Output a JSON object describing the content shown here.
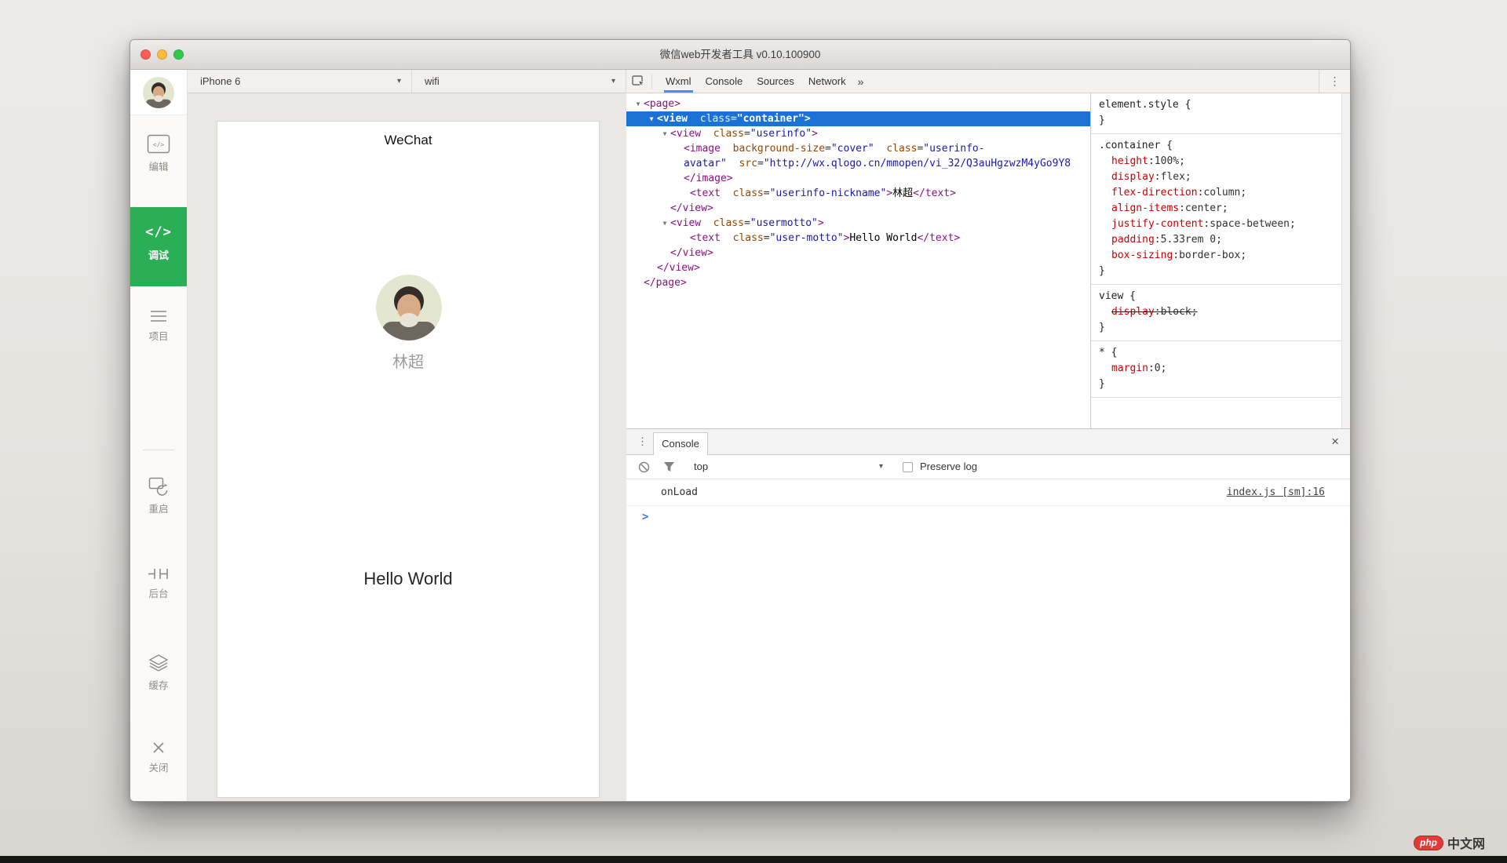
{
  "window": {
    "title": "微信web开发者工具 v0.10.100900"
  },
  "sidebar": {
    "items": [
      {
        "id": "edit",
        "label": "编辑"
      },
      {
        "id": "debug",
        "label": "调试",
        "active": true,
        "icon_glyph": "</>"
      },
      {
        "id": "project",
        "label": "项目"
      },
      {
        "id": "restart",
        "label": "重启"
      },
      {
        "id": "background",
        "label": "后台"
      },
      {
        "id": "cache",
        "label": "缓存"
      },
      {
        "id": "close",
        "label": "关闭"
      }
    ]
  },
  "toolbar": {
    "device": "iPhone 6",
    "network": "wifi"
  },
  "icons": {
    "dropdown_arrow": "▾",
    "expand_arrow": "▼",
    "overflow_tabs": "»",
    "menu_dots": "⋮",
    "close_x": "×"
  },
  "preview": {
    "navbar_title": "WeChat",
    "nickname": "林超",
    "motto": "Hello World"
  },
  "devtools": {
    "tabs": [
      {
        "label": "Wxml",
        "active": true
      },
      {
        "label": "Console",
        "active": false
      },
      {
        "label": "Sources",
        "active": false
      },
      {
        "label": "Network",
        "active": false
      }
    ]
  },
  "wxml_tree": {
    "lines": [
      {
        "indent": 0,
        "arrow": true,
        "selected": false,
        "tokens": [
          [
            "tg",
            "<page>"
          ]
        ]
      },
      {
        "indent": 1,
        "arrow": true,
        "selected": true,
        "tokens": [
          [
            "tg",
            "<view"
          ],
          [
            "pl",
            "  "
          ],
          [
            "at",
            "class"
          ],
          [
            "pl",
            "="
          ],
          [
            "vl",
            "\"container\""
          ],
          [
            "tg",
            ">"
          ]
        ]
      },
      {
        "indent": 2,
        "arrow": true,
        "selected": false,
        "tokens": [
          [
            "tg",
            "<view"
          ],
          [
            "pl",
            "  "
          ],
          [
            "at",
            "class"
          ],
          [
            "pl",
            "="
          ],
          [
            "vl",
            "\"userinfo\""
          ],
          [
            "tg",
            ">"
          ]
        ]
      },
      {
        "indent": 3,
        "arrow": false,
        "selected": false,
        "tokens": [
          [
            "tg",
            "<image"
          ],
          [
            "pl",
            "  "
          ],
          [
            "at",
            "background-size"
          ],
          [
            "pl",
            "="
          ],
          [
            "vl",
            "\"cover\""
          ],
          [
            "pl",
            "  "
          ],
          [
            "at",
            "class"
          ],
          [
            "pl",
            "="
          ],
          [
            "vl",
            "\"userinfo-"
          ]
        ]
      },
      {
        "indent": 3,
        "arrow": false,
        "selected": false,
        "tokens": [
          [
            "vl",
            "avatar\""
          ],
          [
            "pl",
            "  "
          ],
          [
            "at",
            "src"
          ],
          [
            "pl",
            "="
          ],
          [
            "vl",
            "\"http://wx.qlogo.cn/mmopen/vi_32/Q3auHgzwzM4yGo9Y8"
          ]
        ]
      },
      {
        "indent": 3,
        "arrow": false,
        "selected": false,
        "tokens": [
          [
            "tg",
            "</image>"
          ]
        ]
      },
      {
        "indent": 3,
        "arrow": false,
        "selected": false,
        "tokens": [
          [
            "pl",
            " "
          ],
          [
            "tg",
            "<text"
          ],
          [
            "pl",
            "  "
          ],
          [
            "at",
            "class"
          ],
          [
            "pl",
            "="
          ],
          [
            "vl",
            "\"userinfo-nickname\""
          ],
          [
            "tg",
            ">"
          ],
          [
            "tx",
            "林超"
          ],
          [
            "tg",
            "</text>"
          ]
        ]
      },
      {
        "indent": 2,
        "arrow": false,
        "selected": false,
        "tokens": [
          [
            "tg",
            "</view>"
          ]
        ]
      },
      {
        "indent": 2,
        "arrow": true,
        "selected": false,
        "tokens": [
          [
            "tg",
            "<view"
          ],
          [
            "pl",
            "  "
          ],
          [
            "at",
            "class"
          ],
          [
            "pl",
            "="
          ],
          [
            "vl",
            "\"usermotto\""
          ],
          [
            "tg",
            ">"
          ]
        ]
      },
      {
        "indent": 3,
        "arrow": false,
        "selected": false,
        "tokens": [
          [
            "pl",
            " "
          ],
          [
            "tg",
            "<text"
          ],
          [
            "pl",
            "  "
          ],
          [
            "at",
            "class"
          ],
          [
            "pl",
            "="
          ],
          [
            "vl",
            "\"user-motto\""
          ],
          [
            "tg",
            ">"
          ],
          [
            "tx",
            "Hello World"
          ],
          [
            "tg",
            "</text>"
          ]
        ]
      },
      {
        "indent": 2,
        "arrow": false,
        "selected": false,
        "tokens": [
          [
            "tg",
            "</view>"
          ]
        ]
      },
      {
        "indent": 1,
        "arrow": false,
        "selected": false,
        "tokens": [
          [
            "tg",
            "</view>"
          ]
        ]
      },
      {
        "indent": 0,
        "arrow": false,
        "selected": false,
        "tokens": [
          [
            "tg",
            "</page>"
          ]
        ]
      }
    ]
  },
  "style_rules": [
    {
      "selector": "element.style",
      "props": []
    },
    {
      "selector": ".container",
      "props": [
        {
          "name": "height",
          "value": "100%",
          "struck": false
        },
        {
          "name": "display",
          "value": "flex",
          "struck": false
        },
        {
          "name": "flex-direction",
          "value": "column",
          "struck": false
        },
        {
          "name": "align-items",
          "value": "center",
          "struck": false
        },
        {
          "name": "justify-content",
          "value": "space-between",
          "struck": false
        },
        {
          "name": "padding",
          "value": "5.33rem 0",
          "struck": false
        },
        {
          "name": "box-sizing",
          "value": "border-box",
          "struck": false
        }
      ]
    },
    {
      "selector": "view",
      "props": [
        {
          "name": "display",
          "value": "block",
          "struck": true
        }
      ]
    },
    {
      "selector": "*",
      "props": [
        {
          "name": "margin",
          "value": "0",
          "struck": false
        }
      ]
    }
  ],
  "console_panel": {
    "tab": "Console",
    "context": "top",
    "preserve_label": "Preserve log",
    "log_message": "onLoad",
    "log_source": "index.js [sm]:16",
    "prompt": ">"
  },
  "watermark": {
    "badge": "php",
    "text": "中文网"
  }
}
